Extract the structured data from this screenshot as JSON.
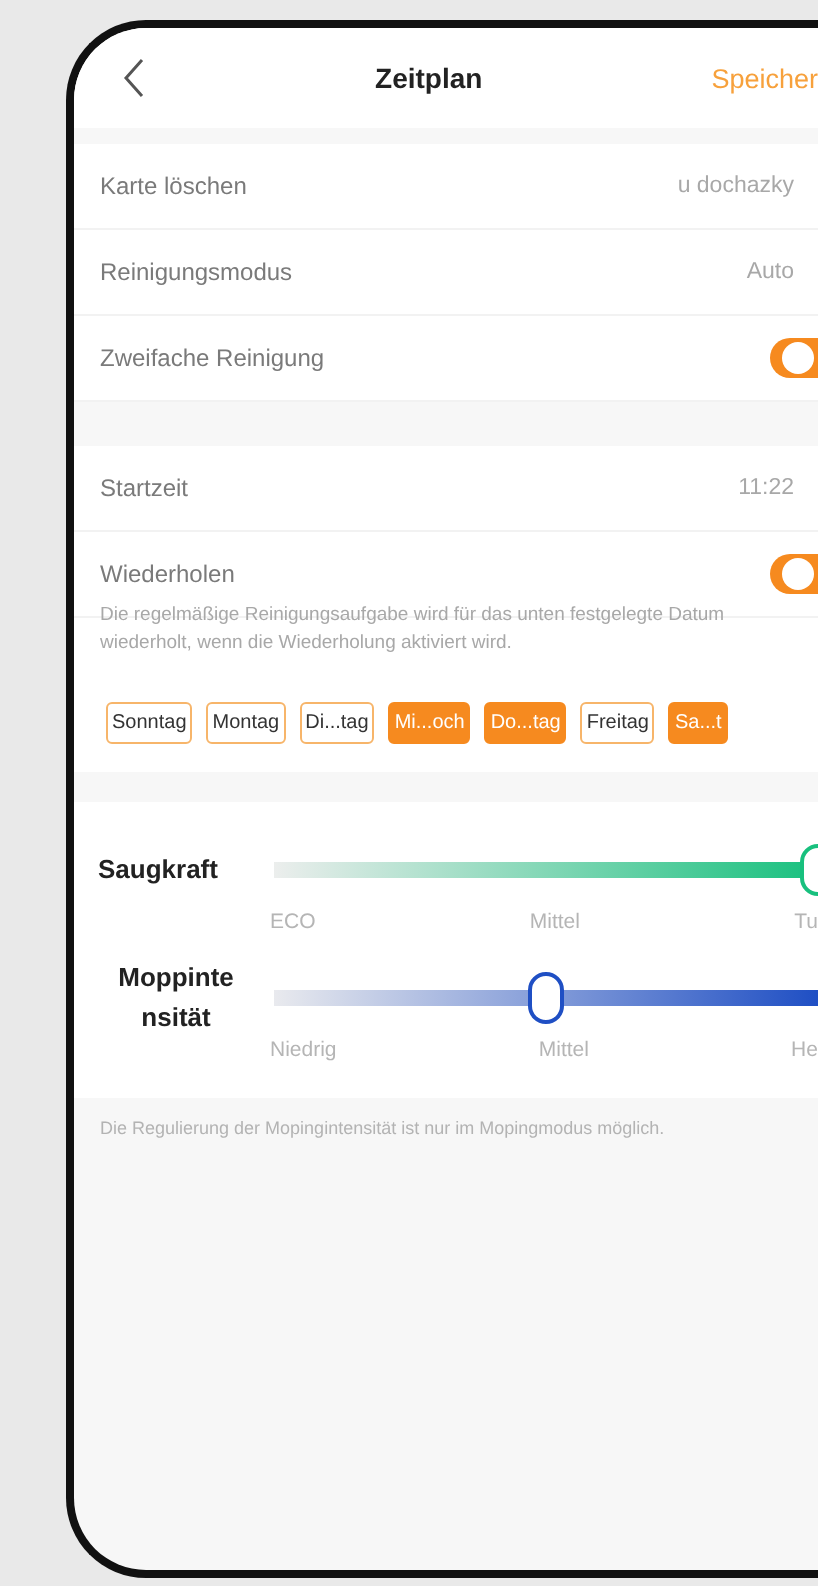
{
  "header": {
    "title": "Zeitplan",
    "action": "Speicher"
  },
  "settings": [
    {
      "kind": "value",
      "label": "Karte löschen",
      "value": "u dochazky"
    },
    {
      "kind": "value",
      "label": "Reinigungsmodus",
      "value": "Auto"
    },
    {
      "kind": "toggle",
      "label": "Zweifache Reinigung",
      "on": true
    }
  ],
  "schedule": [
    {
      "kind": "value",
      "label": "Startzeit",
      "value": "11:22"
    },
    {
      "kind": "toggle",
      "label": "Wiederholen",
      "on": true
    }
  ],
  "repeat_hint": "Die regelmäßige Reinigungsaufgabe wird für das unten festgelegte Datum wiederholt, wenn die Wiederholung aktiviert wird.",
  "days": [
    {
      "label": "Sonntag",
      "selected": false
    },
    {
      "label": "Montag",
      "selected": false
    },
    {
      "label": "Di...tag",
      "selected": false
    },
    {
      "label": "Mi...och",
      "selected": true
    },
    {
      "label": "Do...tag",
      "selected": true
    },
    {
      "label": "Freitag",
      "selected": false
    },
    {
      "label": "Sa...t",
      "selected": true
    }
  ],
  "sliders": [
    {
      "kind": "suction",
      "label": "Saugkraft",
      "level": 1,
      "ticks": [
        "ECO",
        "Mittel",
        "Tu"
      ]
    },
    {
      "kind": "mop",
      "label": "Moppintensität",
      "level": 0.5,
      "ticks": [
        "Niedrig",
        "Mittel",
        "He"
      ]
    }
  ],
  "note": "Die Regulierung der Mopingintensität ist nur im Mopingmodus möglich."
}
